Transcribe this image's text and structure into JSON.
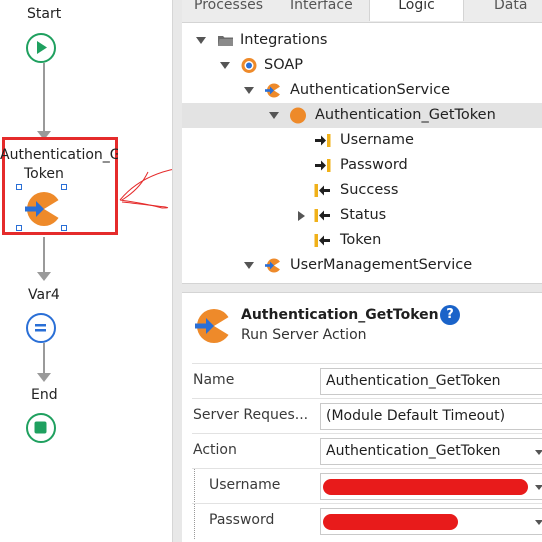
{
  "flow": {
    "start_label": "Start",
    "selected_node_label_line1": "Authentication_Get",
    "selected_node_label_line2": "Token",
    "var_label": "Var4",
    "end_label": "End"
  },
  "tabs": [
    {
      "label": "Processes"
    },
    {
      "label": "Interface"
    },
    {
      "label": "Logic"
    },
    {
      "label": "Data"
    }
  ],
  "tree": {
    "integrations": "Integrations",
    "soap": "SOAP",
    "auth_service": "AuthenticationService",
    "get_token": "Authentication_GetToken",
    "username": "Username",
    "password": "Password",
    "success": "Success",
    "status": "Status",
    "token": "Token",
    "user_mgmt": "UserManagementService"
  },
  "properties": {
    "title": "Authentication_GetToken",
    "subtitle": "Run Server Action",
    "help": "?",
    "rows": [
      {
        "label": "Name",
        "value": "Authentication_GetToken"
      },
      {
        "label": "Server Reques...",
        "value": "(Module Default Timeout)"
      },
      {
        "label": "Action",
        "value": "Authentication_GetToken"
      },
      {
        "label": "Username",
        "value": ""
      },
      {
        "label": "Password",
        "value": ""
      }
    ]
  },
  "colors": {
    "accent_orange": "#ee8a2a",
    "arrow_blue": "#2a6fd6",
    "flow_green": "#1fa05f",
    "annotation_red": "#e52b2b"
  }
}
